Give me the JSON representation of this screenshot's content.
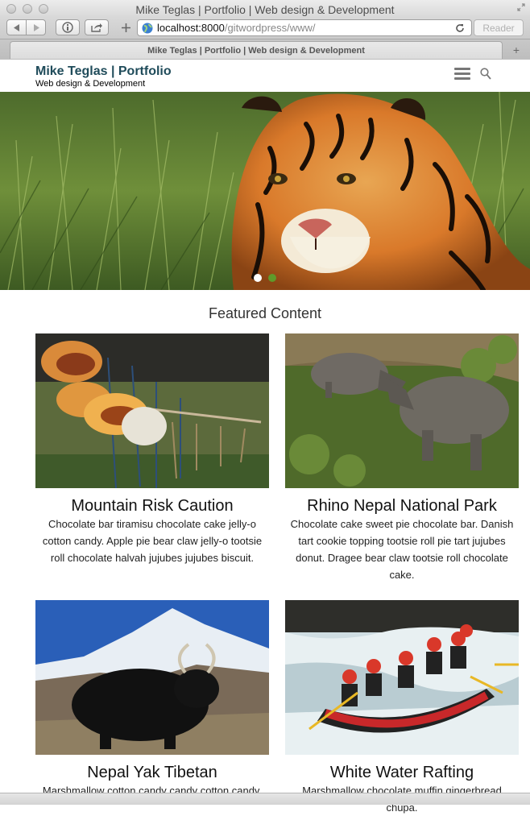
{
  "browser": {
    "window_title": "Mike Teglas | Portfolio | Web design & Development",
    "url_host": "localhost:8000",
    "url_path": "/gitwordpress/www/",
    "reader_label": "Reader",
    "tab_title": "Mike Teglas | Portfolio | Web design & Development",
    "new_tab_symbol": "+"
  },
  "site": {
    "title": "Mike Teglas | Portfolio",
    "description": "Web design & Development"
  },
  "hero": {
    "slide_count": 2,
    "active_slide": 1,
    "colors": {
      "active_dot": "#ffffff",
      "inactive_dot": "#5f9a2a"
    }
  },
  "featured": {
    "heading": "Featured Content",
    "cards": [
      {
        "title": "Mountain Risk Caution",
        "text": "Chocolate bar tiramisu chocolate cake jelly-o cotton candy. Apple pie bear claw jelly-o tootsie roll chocolate halvah jujubes jujubes biscuit."
      },
      {
        "title": "Rhino Nepal National Park",
        "text": "Chocolate cake sweet pie chocolate bar. Danish tart cookie topping tootsie roll pie tart jujubes donut. Dragee bear claw tootsie roll chocolate cake."
      },
      {
        "title": "Nepal Yak Tibetan",
        "text": "Marshmallow cotton candy candy cotton candy."
      },
      {
        "title": "White Water Rafting",
        "text": "Marshmallow chocolate muffin gingerbread chupa."
      }
    ]
  },
  "icons": [
    "back-icon",
    "forward-icon",
    "info-icon",
    "share-icon",
    "add-bookmark-icon",
    "globe-icon",
    "reload-icon",
    "menu-icon",
    "search-icon"
  ]
}
